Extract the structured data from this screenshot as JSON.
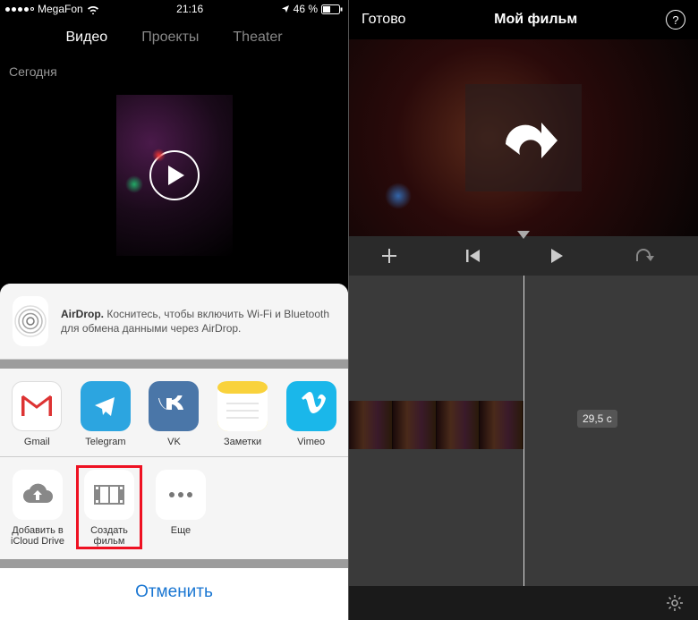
{
  "left": {
    "status": {
      "carrier": "MegaFon",
      "time": "21:16",
      "battery": "46 %"
    },
    "tabs": {
      "video": "Видео",
      "projects": "Проекты",
      "theater": "Theater"
    },
    "section": "Сегодня",
    "airdrop": {
      "title": "AirDrop.",
      "text": "Коснитесь, чтобы включить Wi-Fi и Bluetooth для обмена данными через AirDrop."
    },
    "apps": {
      "gmail": "Gmail",
      "telegram": "Telegram",
      "vk": "VK",
      "notes": "Заметки",
      "vimeo": "Vimeo"
    },
    "actions": {
      "icloud_line1": "Добавить в",
      "icloud_line2": "iCloud Drive",
      "create_line1": "Создать",
      "create_line2": "фильм",
      "more": "Еще"
    },
    "cancel": "Отменить"
  },
  "right": {
    "done": "Готово",
    "title": "Мой фильм",
    "help": "?",
    "time_tag": "29,5 с"
  }
}
